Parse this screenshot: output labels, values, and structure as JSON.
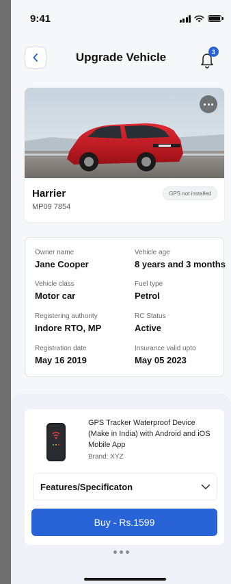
{
  "status_bar": {
    "time": "9:41"
  },
  "header": {
    "title": "Upgrade Vehicle",
    "notification_count": "3"
  },
  "vehicle": {
    "name": "Harrier",
    "plate": "MP09 7854",
    "gps_status": "GPS not installed"
  },
  "details": [
    {
      "label": "Owner name",
      "value": "Jane Cooper"
    },
    {
      "label": "Vehicle age",
      "value": "8 years and 3 months"
    },
    {
      "label": "Vehicle class",
      "value": "Motor car"
    },
    {
      "label": "Fuel type",
      "value": "Petrol"
    },
    {
      "label": "Registering authority",
      "value": "Indore RTO, MP"
    },
    {
      "label": "RC Status",
      "value": "Active"
    },
    {
      "label": "Registration date",
      "value": "May 16 2019"
    },
    {
      "label": "Insurance valid upto",
      "value": "May 05 2023"
    }
  ],
  "product": {
    "title": "GPS Tracker Waterproof Device (Make in India) with Android and iOS Mobile App",
    "brand": "Brand: XYZ",
    "features_label": "Features/Specificaton",
    "buy_label": "Buy - Rs.1599"
  },
  "colors": {
    "accent": "#2864d8",
    "car_body": "#c5161f",
    "background": "#f6f7f9",
    "sheet": "#eef2f8"
  },
  "icons": [
    "back-chevron-icon",
    "bell-icon",
    "more-horizontal-icon",
    "chevron-down-icon",
    "signal-icon",
    "wifi-icon",
    "battery-icon"
  ]
}
